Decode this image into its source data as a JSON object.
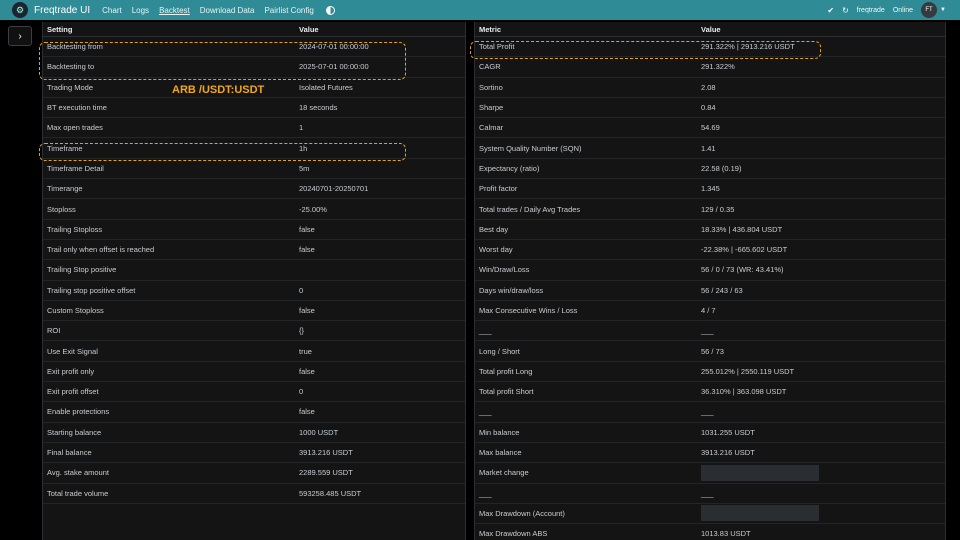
{
  "nav": {
    "brand": "Freqtrade UI",
    "links": [
      "Chart",
      "Logs",
      "Backtest",
      "Download Data",
      "Pairlist Config"
    ],
    "bot_name": "freqtrade",
    "bot_status": "Online",
    "avatar": "FT"
  },
  "annotation": "ARB /USDT:USDT",
  "left_table": {
    "headers": [
      "Setting",
      "Value"
    ],
    "rows": [
      [
        "Backtesting from",
        "2024-07-01 00:00:00"
      ],
      [
        "Backtesting to",
        "2025-07-01 00:00:00"
      ],
      [
        "Trading Mode",
        "Isolated Futures"
      ],
      [
        "BT execution time",
        "18 seconds"
      ],
      [
        "Max open trades",
        "1"
      ],
      [
        "Timeframe",
        "1h"
      ],
      [
        "Timeframe Detail",
        "5m"
      ],
      [
        "Timerange",
        "20240701-20250701"
      ],
      [
        "Stoploss",
        "-25.00%"
      ],
      [
        "Trailing Stoploss",
        "false"
      ],
      [
        "Trail only when offset is reached",
        "false"
      ],
      [
        "Trailing Stop positive",
        ""
      ],
      [
        "Trailing stop positive offset",
        "0"
      ],
      [
        "Custom Stoploss",
        "false"
      ],
      [
        "ROI",
        "{}"
      ],
      [
        "Use Exit Signal",
        "true"
      ],
      [
        "Exit profit only",
        "false"
      ],
      [
        "Exit profit offset",
        "0"
      ],
      [
        "Enable protections",
        "false"
      ],
      [
        "Starting balance",
        "1000 USDT"
      ],
      [
        "Final balance",
        "3913.216 USDT"
      ],
      [
        "Avg. stake amount",
        "2289.559 USDT"
      ],
      [
        "Total trade volume",
        "593258.485 USDT"
      ]
    ]
  },
  "right_table": {
    "headers": [
      "Metric",
      "Value"
    ],
    "rows": [
      [
        "Total Profit",
        "291.322% | 2913.216 USDT"
      ],
      [
        "CAGR",
        "291.322%"
      ],
      [
        "Sortino",
        "2.08"
      ],
      [
        "Sharpe",
        "0.84"
      ],
      [
        "Calmar",
        "54.69"
      ],
      [
        "System Quality Number (SQN)",
        "1.41"
      ],
      [
        "Expectancy (ratio)",
        "22.58 (0.19)"
      ],
      [
        "Profit factor",
        "1.345"
      ],
      [
        "Total trades / Daily Avg Trades",
        "129 / 0.35"
      ],
      [
        "Best day",
        "18.33% | 436.804 USDT"
      ],
      [
        "Worst day",
        "-22.38% | -665.602 USDT"
      ],
      [
        "Win/Draw/Loss",
        "56 / 0 / 73 (WR: 43.41%)"
      ],
      [
        "Days win/draw/loss",
        "56 / 243 / 63"
      ],
      [
        "Max Consecutive Wins / Loss",
        "4 / 7"
      ],
      [
        "___",
        "___"
      ],
      [
        "Long / Short",
        "56 / 73"
      ],
      [
        "Total profit Long",
        "255.012% | 2550.119 USDT"
      ],
      [
        "Total profit Short",
        "36.310% | 363.098 USDT"
      ],
      [
        "___",
        "___"
      ],
      [
        "Min balance",
        "1031.255 USDT"
      ],
      [
        "Max balance",
        "3913.216 USDT"
      ],
      [
        "Market change",
        ""
      ],
      [
        "___",
        "___"
      ],
      [
        "Max Drawdown (Account)",
        ""
      ],
      [
        "Max Drawdown ABS",
        "1013.83 USDT"
      ]
    ],
    "redacted_rows": [
      21,
      23
    ]
  },
  "colors": {
    "navbar": "#2f8b95",
    "highlight": "#e6a21a",
    "annotation": "#f0a818"
  }
}
